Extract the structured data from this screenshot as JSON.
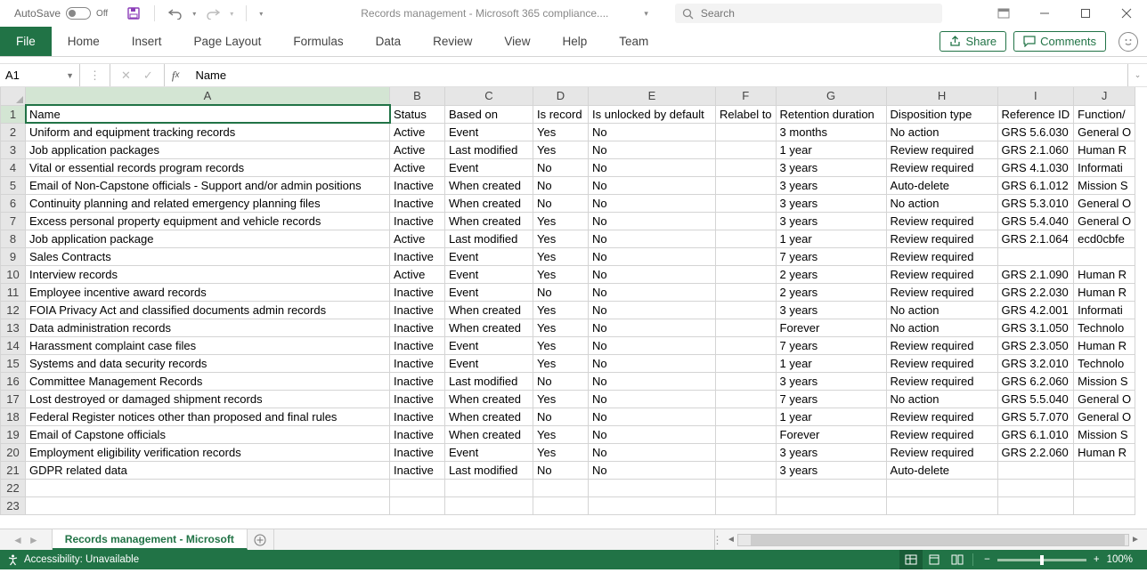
{
  "titlebar": {
    "autosave_label": "AutoSave",
    "autosave_state": "Off",
    "doc_title": "Records management - Microsoft 365 compliance....",
    "search_placeholder": "Search"
  },
  "ribbon": {
    "file": "File",
    "tabs": [
      "Home",
      "Insert",
      "Page Layout",
      "Formulas",
      "Data",
      "Review",
      "View",
      "Help",
      "Team"
    ],
    "share": "Share",
    "comments": "Comments"
  },
  "formula": {
    "name_box": "A1",
    "value": "Name"
  },
  "columns": [
    "A",
    "B",
    "C",
    "D",
    "E",
    "F",
    "G",
    "H",
    "I",
    "J"
  ],
  "headers": [
    "Name",
    "Status",
    "Based on",
    "Is record",
    "Is unlocked by default",
    "Relabel to",
    "Retention duration",
    "Disposition type",
    "Reference ID",
    "Function/"
  ],
  "rows": [
    [
      "Uniform and equipment tracking records",
      "Active",
      "Event",
      "Yes",
      "No",
      "",
      "3 months",
      "No action",
      "GRS 5.6.030",
      "General O"
    ],
    [
      "Job application packages",
      "Active",
      "Last modified",
      "Yes",
      "No",
      "",
      "1 year",
      "Review required",
      "GRS 2.1.060",
      "Human R"
    ],
    [
      "Vital or essential records program records",
      "Active",
      "Event",
      "No",
      "No",
      "",
      "3 years",
      "Review required",
      "GRS 4.1.030",
      "Informati"
    ],
    [
      "Email of Non-Capstone officials - Support and/or admin positions",
      "Inactive",
      "When created",
      "No",
      "No",
      "",
      "3 years",
      "Auto-delete",
      "GRS 6.1.012",
      "Mission S"
    ],
    [
      "Continuity planning and related emergency planning files",
      "Inactive",
      "When created",
      "No",
      "No",
      "",
      "3 years",
      "No action",
      "GRS 5.3.010",
      "General O"
    ],
    [
      "Excess personal property equipment and vehicle records",
      "Inactive",
      "When created",
      "Yes",
      "No",
      "",
      "3 years",
      "Review required",
      "GRS 5.4.040",
      "General O"
    ],
    [
      "Job application package",
      "Active",
      "Last modified",
      "Yes",
      "No",
      "",
      "1 year",
      "Review required",
      "GRS 2.1.064",
      "ecd0cbfe"
    ],
    [
      "Sales Contracts",
      "Inactive",
      "Event",
      "Yes",
      "No",
      "",
      "7 years",
      "Review required",
      "",
      ""
    ],
    [
      "Interview records",
      "Active",
      "Event",
      "Yes",
      "No",
      "",
      "2 years",
      "Review required",
      "GRS 2.1.090",
      "Human R"
    ],
    [
      "Employee incentive award records",
      "Inactive",
      "Event",
      "No",
      "No",
      "",
      "2 years",
      "Review required",
      "GRS 2.2.030",
      "Human R"
    ],
    [
      "FOIA Privacy Act and classified documents admin records",
      "Inactive",
      "When created",
      "Yes",
      "No",
      "",
      "3 years",
      "No action",
      "GRS 4.2.001",
      "Informati"
    ],
    [
      "Data administration records",
      "Inactive",
      "When created",
      "Yes",
      "No",
      "",
      "Forever",
      "No action",
      "GRS 3.1.050",
      "Technolo"
    ],
    [
      "Harassment complaint case files",
      "Inactive",
      "Event",
      "Yes",
      "No",
      "",
      "7 years",
      "Review required",
      "GRS 2.3.050",
      "Human R"
    ],
    [
      "Systems and data security records",
      "Inactive",
      "Event",
      "Yes",
      "No",
      "",
      "1 year",
      "Review required",
      "GRS 3.2.010",
      "Technolo"
    ],
    [
      "Committee Management Records",
      "Inactive",
      "Last modified",
      "No",
      "No",
      "",
      "3 years",
      "Review required",
      "GRS 6.2.060",
      "Mission S"
    ],
    [
      "Lost destroyed or damaged shipment records",
      "Inactive",
      "When created",
      "Yes",
      "No",
      "",
      "7 years",
      "No action",
      "GRS 5.5.040",
      "General O"
    ],
    [
      "Federal Register notices other than proposed and final rules",
      "Inactive",
      "When created",
      "No",
      "No",
      "",
      "1 year",
      "Review required",
      "GRS 5.7.070",
      "General O"
    ],
    [
      "Email of Capstone officials",
      "Inactive",
      "When created",
      "Yes",
      "No",
      "",
      "Forever",
      "Review required",
      "GRS 6.1.010",
      "Mission S"
    ],
    [
      "Employment eligibility verification records",
      "Inactive",
      "Event",
      "Yes",
      "No",
      "",
      "3 years",
      "Review required",
      "GRS 2.2.060",
      "Human R"
    ],
    [
      "GDPR related data",
      "Inactive",
      "Last modified",
      "No",
      "No",
      "",
      "3 years",
      "Auto-delete",
      "",
      ""
    ]
  ],
  "sheet": {
    "active_tab": "Records management - Microsoft"
  },
  "statusbar": {
    "accessibility": "Accessibility: Unavailable",
    "zoom": "100%"
  }
}
